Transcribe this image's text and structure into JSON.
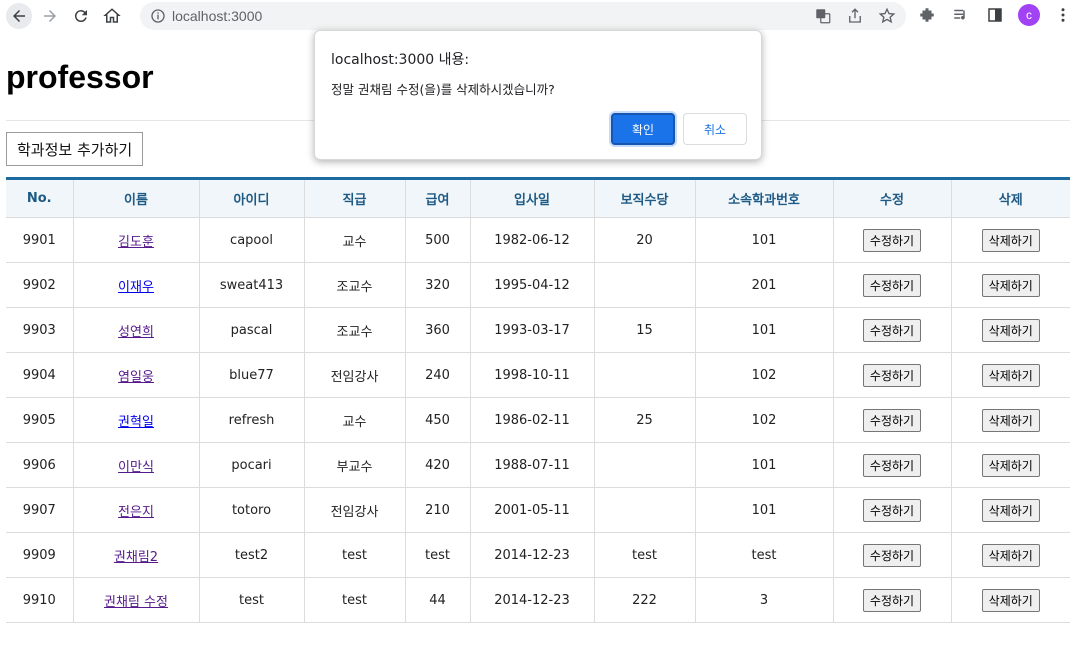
{
  "browser": {
    "url": "localhost:3000",
    "profile_initial": "c"
  },
  "page": {
    "title": "professor",
    "add_button": "학과정보 추가하기"
  },
  "table": {
    "headers": [
      "No.",
      "이름",
      "아이디",
      "직급",
      "급여",
      "입사일",
      "보직수당",
      "소속학과번호",
      "수정",
      "삭제"
    ],
    "edit_label": "수정하기",
    "delete_label": "삭제하기",
    "rows": [
      {
        "no": "9901",
        "name": "김도훈",
        "id": "capool",
        "rank": "교수",
        "pay": "500",
        "hiredate": "1982-06-12",
        "bonus": "20",
        "dept": "101",
        "visited": true
      },
      {
        "no": "9902",
        "name": "이재우",
        "id": "sweat413",
        "rank": "조교수",
        "pay": "320",
        "hiredate": "1995-04-12",
        "bonus": "",
        "dept": "201",
        "visited": false
      },
      {
        "no": "9903",
        "name": "성연희",
        "id": "pascal",
        "rank": "조교수",
        "pay": "360",
        "hiredate": "1993-03-17",
        "bonus": "15",
        "dept": "101",
        "visited": true
      },
      {
        "no": "9904",
        "name": "염일웅",
        "id": "blue77",
        "rank": "전임강사",
        "pay": "240",
        "hiredate": "1998-10-11",
        "bonus": "",
        "dept": "102",
        "visited": true
      },
      {
        "no": "9905",
        "name": "권혁일",
        "id": "refresh",
        "rank": "교수",
        "pay": "450",
        "hiredate": "1986-02-11",
        "bonus": "25",
        "dept": "102",
        "visited": false
      },
      {
        "no": "9906",
        "name": "이만식",
        "id": "pocari",
        "rank": "부교수",
        "pay": "420",
        "hiredate": "1988-07-11",
        "bonus": "",
        "dept": "101",
        "visited": true
      },
      {
        "no": "9907",
        "name": "전은지",
        "id": "totoro",
        "rank": "전임강사",
        "pay": "210",
        "hiredate": "2001-05-11",
        "bonus": "",
        "dept": "101",
        "visited": true
      },
      {
        "no": "9909",
        "name": "권채림2",
        "id": "test2",
        "rank": "test",
        "pay": "test",
        "hiredate": "2014-12-23",
        "bonus": "test",
        "dept": "test",
        "visited": true
      },
      {
        "no": "9910",
        "name": "권채림 수정",
        "id": "test",
        "rank": "test",
        "pay": "44",
        "hiredate": "2014-12-23",
        "bonus": "222",
        "dept": "3",
        "visited": true
      }
    ]
  },
  "dialog": {
    "title": "localhost:3000 내용:",
    "message": "정말 권채림 수정(을)를 삭제하시겠습니까?",
    "ok_label": "확인",
    "cancel_label": "취소"
  }
}
